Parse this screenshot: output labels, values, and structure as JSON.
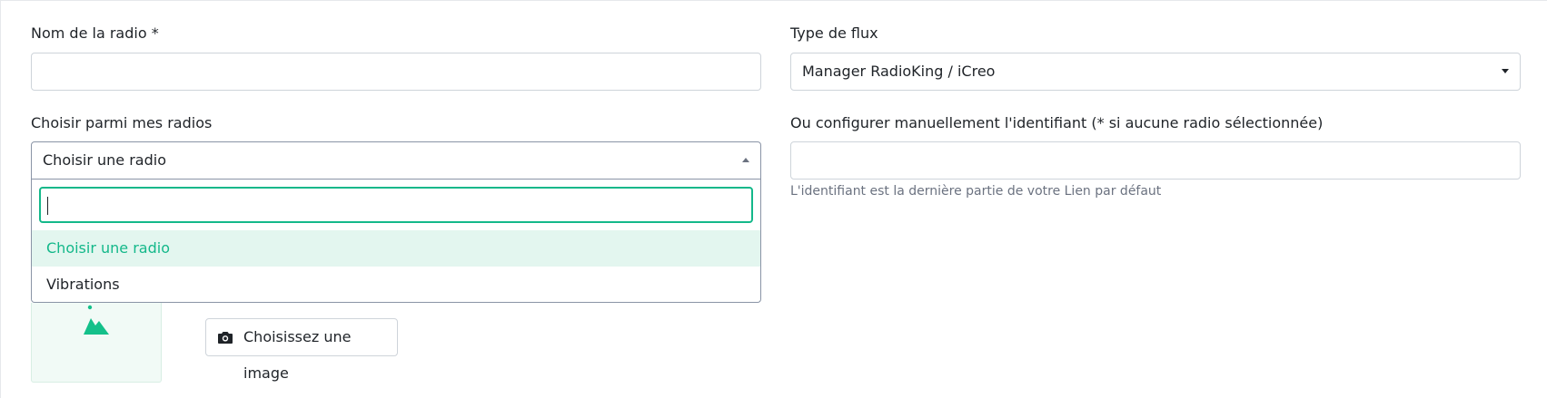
{
  "form": {
    "radio_name": {
      "label": "Nom de la radio *",
      "value": ""
    },
    "stream_type": {
      "label": "Type de flux",
      "selected": "Manager RadioKing / iCreo"
    },
    "choose_radio": {
      "label": "Choisir parmi mes radios",
      "selected": "Choisir une radio",
      "search_value": "",
      "options": [
        "Choisir une radio",
        "Vibrations"
      ]
    },
    "identifier": {
      "label": "Ou configurer manuellement l'identifiant (* si aucune radio sélectionnée)",
      "value": "",
      "help": "L'identifiant est la dernière partie de votre Lien par défaut"
    },
    "image": {
      "placeholder_icon": "image-icon",
      "button_icon": "camera-icon",
      "button_label": "Choisissez une image"
    }
  },
  "colors": {
    "accent": "#14b88a",
    "accent_bg": "#e3f6ef"
  }
}
